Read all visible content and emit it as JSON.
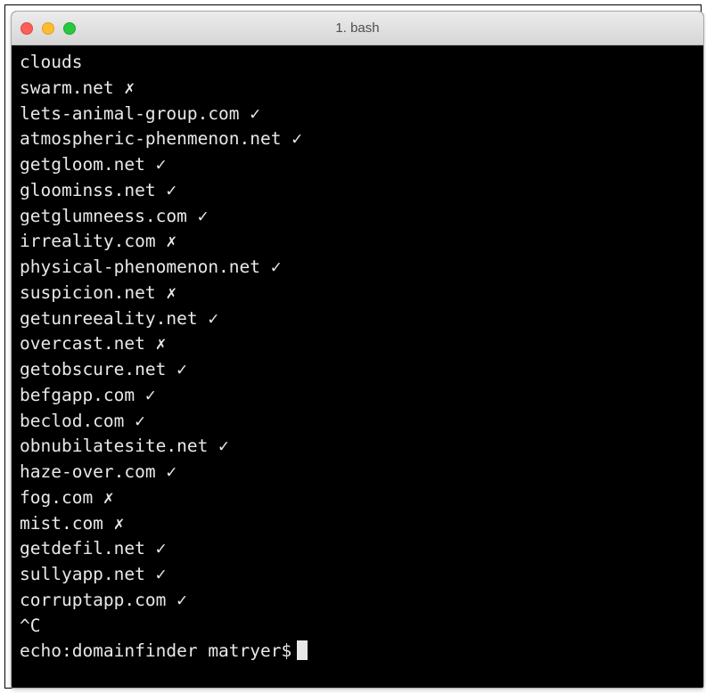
{
  "window": {
    "title": "1. bash",
    "colors": {
      "close": "#fc5f57",
      "minimize": "#fdbc2e",
      "maximize": "#28c840",
      "terminal_background": "#000000",
      "terminal_text": "#e8e8e8"
    }
  },
  "terminal": {
    "lines": [
      "clouds",
      "swarm.net ✗",
      "lets-animal-group.com ✓",
      "atmospheric-phenmenon.net ✓",
      "getgloom.net ✓",
      "gloominss.net ✓",
      "getglumneess.com ✓",
      "irreality.com ✗",
      "physical-phenomenon.net ✓",
      "suspicion.net ✗",
      "getunreeality.net ✓",
      "overcast.net ✗",
      "getobscure.net ✓",
      "befgapp.com ✓",
      "beclod.com ✓",
      "obnubilatesite.net ✓",
      "haze-over.com ✓",
      "fog.com ✗",
      "mist.com ✗",
      "getdefil.net ✓",
      "sullyapp.net ✓",
      "corruptapp.com ✓",
      "^C"
    ],
    "prompt": "echo:domainfinder matryer$"
  }
}
